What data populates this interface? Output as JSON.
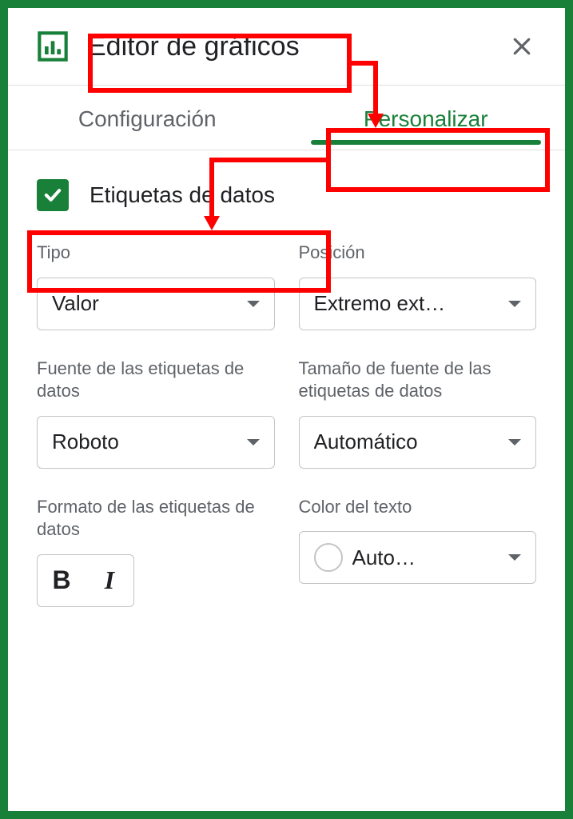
{
  "header": {
    "title": "Editor de gráficos"
  },
  "tabs": {
    "config": "Configuración",
    "customize": "Personalizar"
  },
  "section": {
    "checkbox_label": "Etiquetas de datos"
  },
  "fields": {
    "type": {
      "label": "Tipo",
      "value": "Valor"
    },
    "position": {
      "label": "Posición",
      "value": "Extremo ext…"
    },
    "font": {
      "label": "Fuente de las etiquetas de datos",
      "value": "Roboto"
    },
    "fontsize": {
      "label": "Tamaño de fuente de las etiquetas de datos",
      "value": "Automático"
    },
    "format": {
      "label": "Formato de las etiquetas de datos"
    },
    "textcolor": {
      "label": "Color del texto",
      "value": "Auto…"
    }
  },
  "format_buttons": {
    "bold": "B",
    "italic": "I"
  }
}
